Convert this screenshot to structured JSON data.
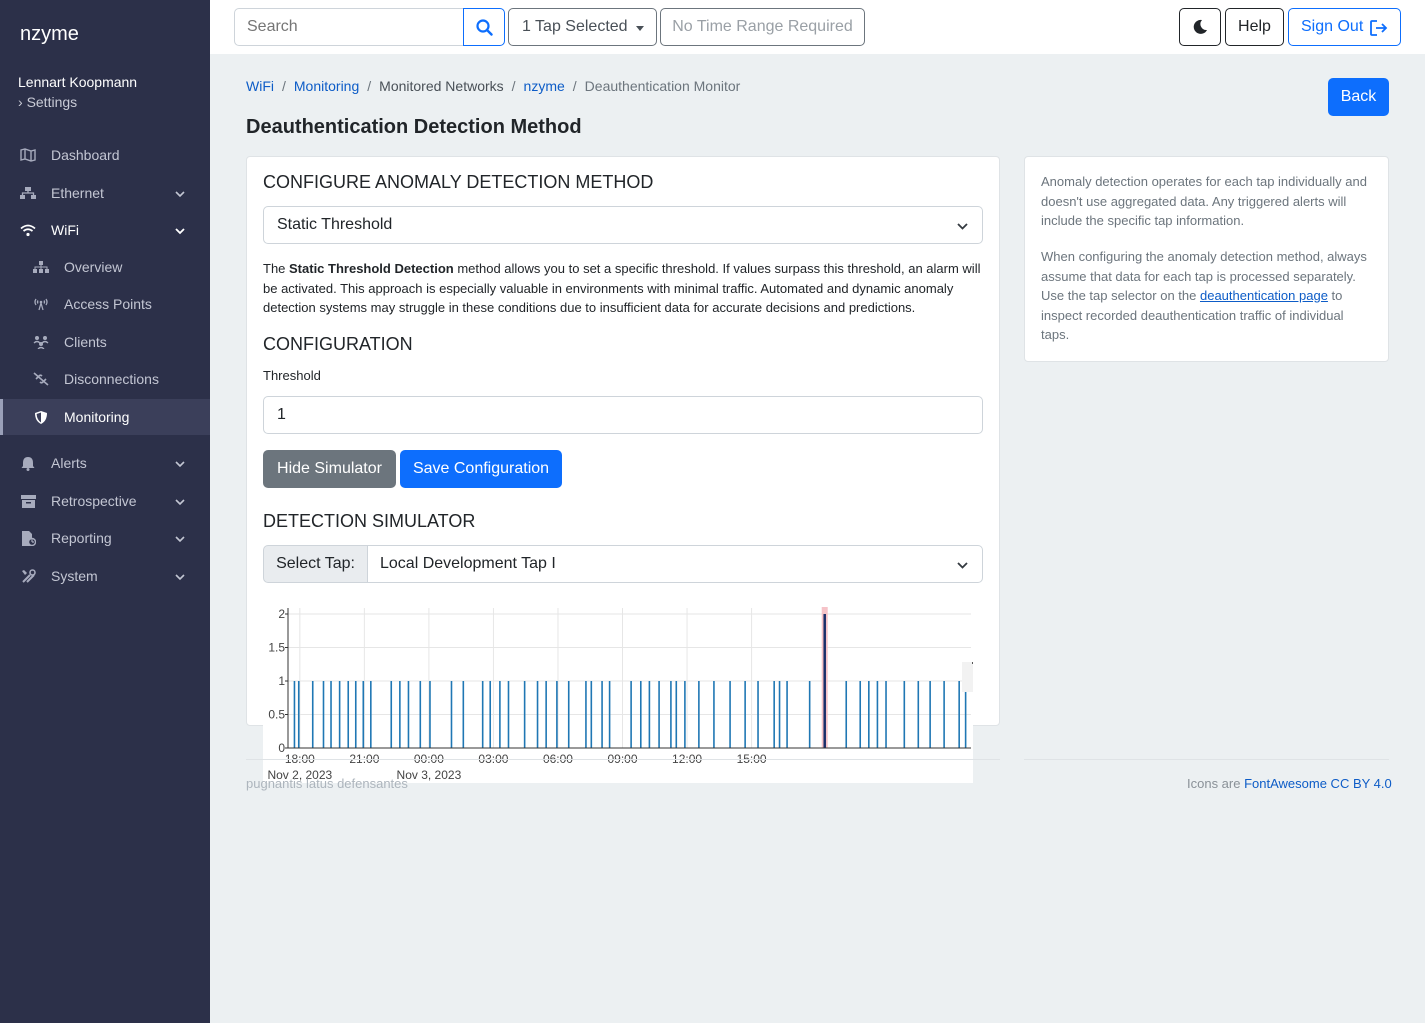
{
  "sidebar": {
    "brand": "nzyme",
    "user_name": "Lennart Koopmann",
    "settings_label": "Settings",
    "items": [
      {
        "label": "Dashboard",
        "icon": "map-icon"
      },
      {
        "label": "Ethernet",
        "icon": "network-icon"
      },
      {
        "label": "WiFi",
        "icon": "wifi-icon"
      },
      {
        "label": "Overview",
        "icon": "sitemap-icon"
      },
      {
        "label": "Access Points",
        "icon": "tower-broadcast-icon"
      },
      {
        "label": "Clients",
        "icon": "clients-icon"
      },
      {
        "label": "Disconnections",
        "icon": "link-slash-icon"
      },
      {
        "label": "Monitoring",
        "icon": "shield-icon"
      },
      {
        "label": "Alerts",
        "icon": "bell-icon"
      },
      {
        "label": "Retrospective",
        "icon": "box-archive-icon"
      },
      {
        "label": "Reporting",
        "icon": "file-report-icon"
      },
      {
        "label": "System",
        "icon": "tools-icon"
      }
    ]
  },
  "topbar": {
    "search_placeholder": "Search",
    "tap_selector": "1 Tap Selected",
    "time_range": "No Time Range Required",
    "help": "Help",
    "sign_out": "Sign Out"
  },
  "breadcrumb": [
    "WiFi",
    "Monitoring",
    "Monitored Networks",
    "nzyme",
    "Deauthentication Monitor"
  ],
  "back_label": "Back",
  "page_title": "Deauthentication Detection Method",
  "configure": {
    "heading": "CONFIGURE ANOMALY DETECTION METHOD",
    "selected_method": "Static Threshold",
    "desc_prefix": "The ",
    "desc_bold": "Static Threshold Detection",
    "desc_rest": " method allows you to set a specific threshold. If values surpass this threshold, an alarm will be activated. This approach is especially valuable in environments with minimal traffic. Automated and dynamic anomaly detection systems may struggle in these conditions due to insufficient data for accurate decisions and predictions."
  },
  "configuration": {
    "heading": "CONFIGURATION",
    "threshold_label": "Threshold",
    "threshold_value": "1",
    "hide_simulator": "Hide Simulator",
    "save": "Save Configuration"
  },
  "simulator": {
    "heading": "DETECTION SIMULATOR",
    "select_tap_label": "Select Tap:",
    "selected_tap": "Local Development Tap I"
  },
  "side_info": {
    "p1": "Anomaly detection operates for each tap individually and doesn't use aggregated data. Any triggered alerts will include the specific tap information.",
    "p2_prefix": "When configuring the anomaly detection method, always assume that data for each tap is processed separately. Use the tap selector on the ",
    "p2_link": "deauthentication page",
    "p2_suffix": " to inspect recorded deauthentication traffic of individual taps."
  },
  "footer": {
    "left": "pugnantis latus defensantes",
    "right_prefix": "Icons are ",
    "right_link": "FontAwesome CC BY 4.0"
  },
  "colors": {
    "sidebar_bg": "#2c3049",
    "primary": "#0d6efd",
    "bar": "#1f77b4",
    "alert_bar": "#d62728"
  },
  "chart_data": {
    "type": "bar",
    "x_unit": "time",
    "x_tick_labels": [
      "18:00",
      "21:00",
      "00:00",
      "03:00",
      "06:00",
      "09:00",
      "12:00",
      "15:00"
    ],
    "x_date_labels": [
      "Nov 2, 2023",
      "Nov 3, 2023"
    ],
    "y_ticks": [
      "0",
      "0.5",
      "1",
      "1.5",
      "2"
    ],
    "ylim": [
      0,
      2
    ],
    "grid": true,
    "bar_times_hours_from_nov2_1800": [
      -0.25,
      -0.05,
      0.6,
      1.1,
      1.45,
      1.85,
      2.25,
      2.6,
      2.95,
      3.3,
      4.25,
      4.65,
      5.05,
      5.6,
      6.05,
      7.05,
      7.6,
      8.5,
      8.85,
      9.3,
      9.7,
      10.45,
      11.05,
      11.45,
      11.95,
      12.5,
      13.3,
      13.55,
      14.05,
      14.4,
      15.4,
      15.85,
      16.25,
      16.7,
      17.25,
      17.5,
      17.9,
      18.55,
      19.25,
      20.0,
      20.7,
      21.3,
      22.05,
      22.3,
      22.65,
      23.7,
      24.4,
      25.4,
      26.05,
      26.45,
      26.85,
      27.25,
      28.1,
      28.75,
      29.3,
      29.95,
      30.65,
      30.95
    ],
    "bar_values": [
      1,
      1,
      1,
      1,
      1,
      1,
      1,
      1,
      1,
      1,
      1,
      1,
      1,
      1,
      1,
      1,
      1,
      1,
      1,
      1,
      1,
      1,
      1,
      1,
      1,
      1,
      1,
      1,
      1,
      1,
      1,
      1,
      1,
      1,
      1,
      1,
      1,
      1,
      1,
      1,
      1,
      1,
      1,
      1,
      1,
      1,
      2,
      1,
      1,
      1,
      1,
      1,
      1,
      1,
      1,
      1,
      1,
      1
    ],
    "threshold": 1
  }
}
